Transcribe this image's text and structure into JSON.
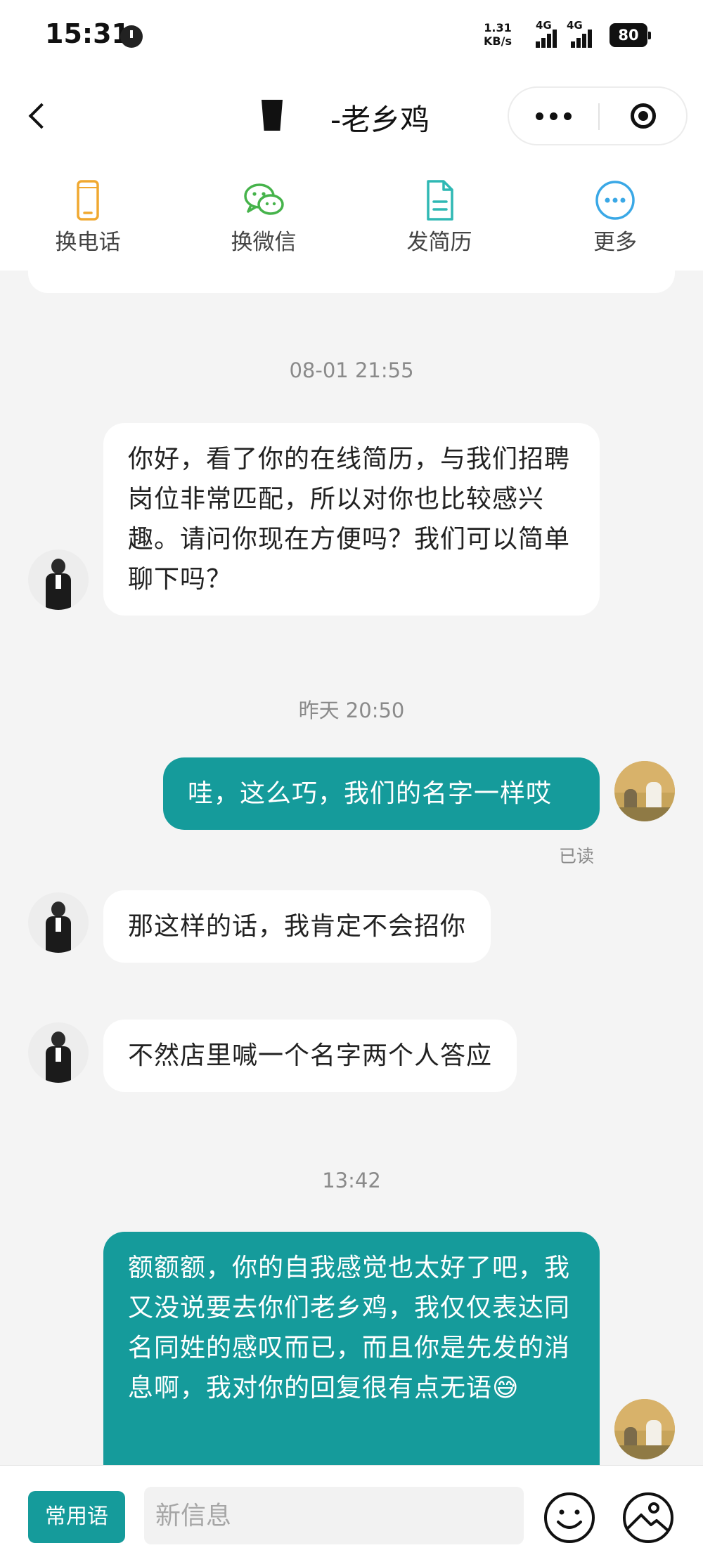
{
  "status_bar": {
    "time": "15:31",
    "net_speed_value": "1.31",
    "net_speed_unit": "KB/s",
    "signal1_label": "4G",
    "signal2_label": "4G",
    "battery": "80"
  },
  "nav": {
    "title": "-老乡鸡"
  },
  "actions": [
    {
      "label": "换电话",
      "icon": "phone-icon",
      "color": "#f0a830"
    },
    {
      "label": "换微信",
      "icon": "wechat-icon",
      "color": "#46b34b"
    },
    {
      "label": "发简历",
      "icon": "resume-icon",
      "color": "#2fb8b4"
    },
    {
      "label": "更多",
      "icon": "more-icon",
      "color": "#3aa8e6"
    }
  ],
  "chat": {
    "timestamp_1": "08-01 21:55",
    "msg_1": "你好，看了你的在线简历，与我们招聘岗位非常匹配，所以对你也比较感兴趣。请问你现在方便吗？我们可以简单聊下吗？",
    "timestamp_2": "昨天 20:50",
    "msg_2": "哇，这么巧，我们的名字一样哎",
    "read_status": "已读",
    "msg_3": "那这样的话，我肯定不会招你",
    "msg_4": "不然店里喊一个名字两个人答应",
    "timestamp_3": "13:42",
    "msg_5": "额额额，你的自我感觉也太好了吧，我又没说要去你们老乡鸡，我仅仅表达同名同姓的感叹而已，而且你是先发的消息啊，我对你的回复很有点无语😅"
  },
  "input_bar": {
    "phrases_label": "常用语",
    "placeholder": "新信息"
  },
  "colors": {
    "accent": "#159b9b",
    "background": "#f4f4f4"
  }
}
